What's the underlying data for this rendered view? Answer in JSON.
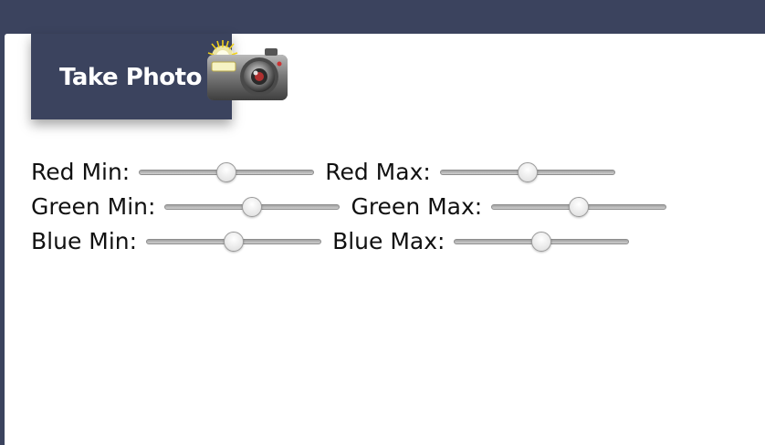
{
  "colors": {
    "header_bar": "#3b435e",
    "button_bg": "#3b435e",
    "button_text": "#ffffff",
    "panel_bg": "#ffffff"
  },
  "take_photo": {
    "label": "Take Photo",
    "icon": "camera-with-flash-icon"
  },
  "sliders": {
    "red_min": {
      "label": "Red Min:",
      "value": 0.5
    },
    "red_max": {
      "label": "Red Max:",
      "value": 0.5
    },
    "green_min": {
      "label": "Green Min:",
      "value": 0.5
    },
    "green_max": {
      "label": "Green Max:",
      "value": 0.5
    },
    "blue_min": {
      "label": "Blue Min:",
      "value": 0.5
    },
    "blue_max": {
      "label": "Blue Max:",
      "value": 0.5
    }
  }
}
